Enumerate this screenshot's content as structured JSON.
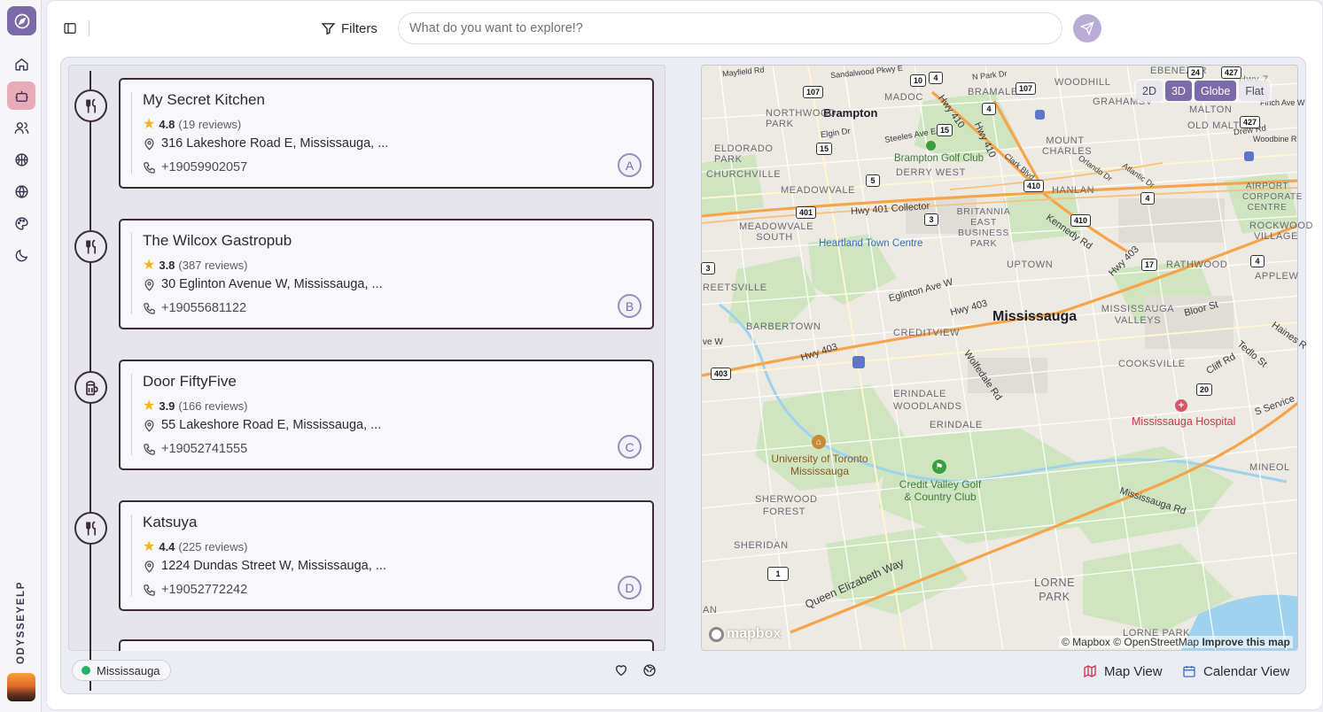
{
  "app": {
    "brand": "ODYSSEYELP"
  },
  "rail": {
    "items": [
      "home-icon",
      "bot-icon",
      "users-icon",
      "basketball-icon",
      "globe-icon",
      "palette-icon",
      "moon-icon"
    ]
  },
  "header": {
    "filters_label": "Filters",
    "search_placeholder": "What do you want to explore!?"
  },
  "results": [
    {
      "name": "My Secret Kitchen",
      "rating": "4.8",
      "reviews": "(19 reviews)",
      "address": "316 Lakeshore Road E, Mississauga, ...",
      "phone": "+19059902057",
      "letter": "A",
      "icon": "utensils-icon"
    },
    {
      "name": "The Wilcox Gastropub",
      "rating": "3.8",
      "reviews": "(387 reviews)",
      "address": "30 Eglinton Avenue W, Mississauga, ...",
      "phone": "+19055681122",
      "letter": "B",
      "icon": "utensils-icon"
    },
    {
      "name": "Door FiftyFive",
      "rating": "3.9",
      "reviews": "(166 reviews)",
      "address": "55 Lakeshore Road E, Mississauga, ...",
      "phone": "+19052741555",
      "letter": "C",
      "icon": "beer-mug-icon"
    },
    {
      "name": "Katsuya",
      "rating": "4.4",
      "reviews": "(225 reviews)",
      "address": "1224 Dundas Street W, Mississauga, ...",
      "phone": "+19052772242",
      "letter": "D",
      "icon": "utensils-icon"
    }
  ],
  "footer": {
    "location_chip": "Mississauga",
    "map_view": "Map View",
    "calendar_view": "Calendar View"
  },
  "map": {
    "modes": [
      "2D",
      "3D",
      "Globe",
      "Flat"
    ],
    "active_modes": [
      "3D",
      "Globe"
    ],
    "attribution": "© Mapbox © OpenStreetMap",
    "improve": "Improve this map",
    "logo": "mapbox",
    "labels": {
      "brampton": "Brampton",
      "mississauga": "Mississauga",
      "brampton_golf": "Brampton Golf Club",
      "heartland": "Heartland Town Centre",
      "uoft": "University of Toronto Mississauga",
      "credit_valley": "Credit Valley Golf & Country Club",
      "hospital": "Mississauga Hospital",
      "northwood_park": "NORTHWOOD PARK",
      "eldorado_park": "ELDORADO PARK",
      "churchville": "CHURCHVILLE",
      "madoc": "MADOC",
      "bramalea": "BRAMALEA",
      "woodhill": "WOODHILL",
      "grahamsville": "GRAHAMSV",
      "malton": "MALTON",
      "mount_charles": "MOUNT CHARLES",
      "old_malton": "OLD MALTON",
      "derry_west": "DERRY WEST",
      "meadowvale": "MEADOWVALE",
      "hanlan": "HANLAN",
      "britannia": "BRITANNIA EAST BUSINESS PARK",
      "meadowvale_south": "MEADOWVALE SOUTH",
      "airport_corporate": "AIRPORT CORPORATE CENTRE",
      "rockwood": "ROCKWOOD VILLAGE",
      "uptown": "UPTOWN",
      "rathwood": "RATHWOOD",
      "applewood": "APPLEW",
      "streetsville": "REETSVILLE",
      "barbertown": "BARBERTOWN",
      "creditview": "CREDITVIEW",
      "mississauga_valleys": "MISSISSAUGA VALLEYS",
      "cooksville": "COOKSVILLE",
      "erindale_woodlands": "ERINDALE WOODLANDS",
      "erindale": "ERINDALE",
      "sherwood_forest": "SHERWOOD FOREST",
      "sheridan": "SHERIDAN",
      "lorne_park": "LORNE PARK",
      "lorne_park_2": "LORNE PARK",
      "mineola": "MINEOL",
      "an": "AN",
      "hwy401_collector": "Hwy 401 Collector",
      "hwy403": "Hwy 403",
      "hwy403b": "Hwy 403",
      "hwy403c": "Hwy 403",
      "hwy410": "Hwy 410",
      "hwy410b": "Hwy 410",
      "eglinton": "Eglinton Ave W",
      "kennedy": "Kennedy Rd",
      "wolfedale": "Wolfedale Rd",
      "bloor": "Bloor St",
      "tedlo": "Tedlo St",
      "cliff": "Cliff Rd",
      "haines": "Haines R",
      "mississauga_rd": "Mississauga Rd",
      "qew": "Queen Elizabeth Way",
      "s_service": "S Service",
      "steeles": "Steeles Ave E",
      "elgin": "Elgin Dr",
      "mayfield": "Mayfield Rd",
      "sandalwood": "Sandalwood Pkwy E",
      "n_park": "N Park Dr",
      "drew": "Drew Rd",
      "orlando": "Orlando Dr",
      "atlantic": "Atlantic Dr",
      "clark": "Clark Blvd",
      "derry": "Derry",
      "ebenezer": "EBENEZER",
      "hwy7": "Hwy 7",
      "finch": "Finch Ave W",
      "woodbine": "Woodbine R",
      "ave_w": "ve W"
    },
    "shields": [
      "107",
      "4",
      "107",
      "10",
      "15",
      "410",
      "4",
      "5",
      "410",
      "3",
      "401",
      "403",
      "4",
      "17",
      "4",
      "403",
      "20",
      "1",
      "24",
      "427",
      "427",
      "3",
      "15",
      "4"
    ]
  }
}
